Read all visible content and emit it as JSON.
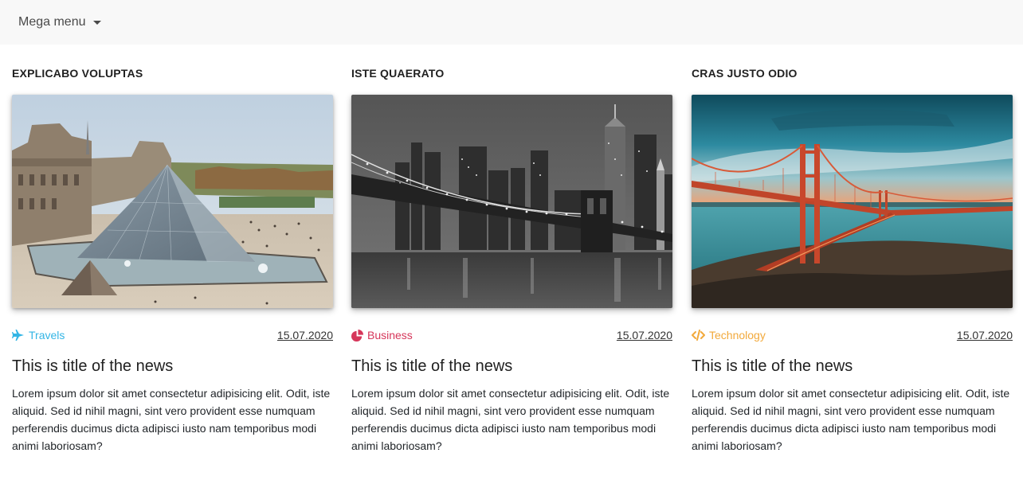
{
  "navbar": {
    "menu_label": "Mega menu"
  },
  "columns": [
    {
      "heading": "EXPLICABO VOLUPTAS",
      "image_alt": "Louvre pyramid in Paris",
      "category": {
        "label": "Travels",
        "icon": "plane-icon",
        "color": "#33b5e5"
      },
      "date": "15.07.2020",
      "title": "This is title of the news",
      "body": "Lorem ipsum dolor sit amet consectetur adipisicing elit. Odit, iste aliquid. Sed id nihil magni, sint vero provident esse numquam perferendis ducimus dicta adipisci iusto nam temporibus modi animi laboriosam?"
    },
    {
      "heading": "ISTE QUAERATO",
      "image_alt": "Brooklyn Bridge and Manhattan skyline at night, black and white",
      "category": {
        "label": "Business",
        "icon": "pie-chart-icon",
        "color": "#d6365a"
      },
      "date": "15.07.2020",
      "title": "This is title of the news",
      "body": "Lorem ipsum dolor sit amet consectetur adipisicing elit. Odit, iste aliquid. Sed id nihil magni, sint vero provident esse numquam perferendis ducimus dicta adipisci iusto nam temporibus modi animi laboriosam?"
    },
    {
      "heading": "CRAS JUSTO ODIO",
      "image_alt": "Golden Gate Bridge at sunset",
      "category": {
        "label": "Technology",
        "icon": "code-icon",
        "color": "#f2a93b"
      },
      "date": "15.07.2020",
      "title": "This is title of the news",
      "body": "Lorem ipsum dolor sit amet consectetur adipisicing elit. Odit, iste aliquid. Sed id nihil magni, sint vero provident esse numquam perferendis ducimus dicta adipisci iusto nam temporibus modi animi laboriosam?"
    }
  ]
}
